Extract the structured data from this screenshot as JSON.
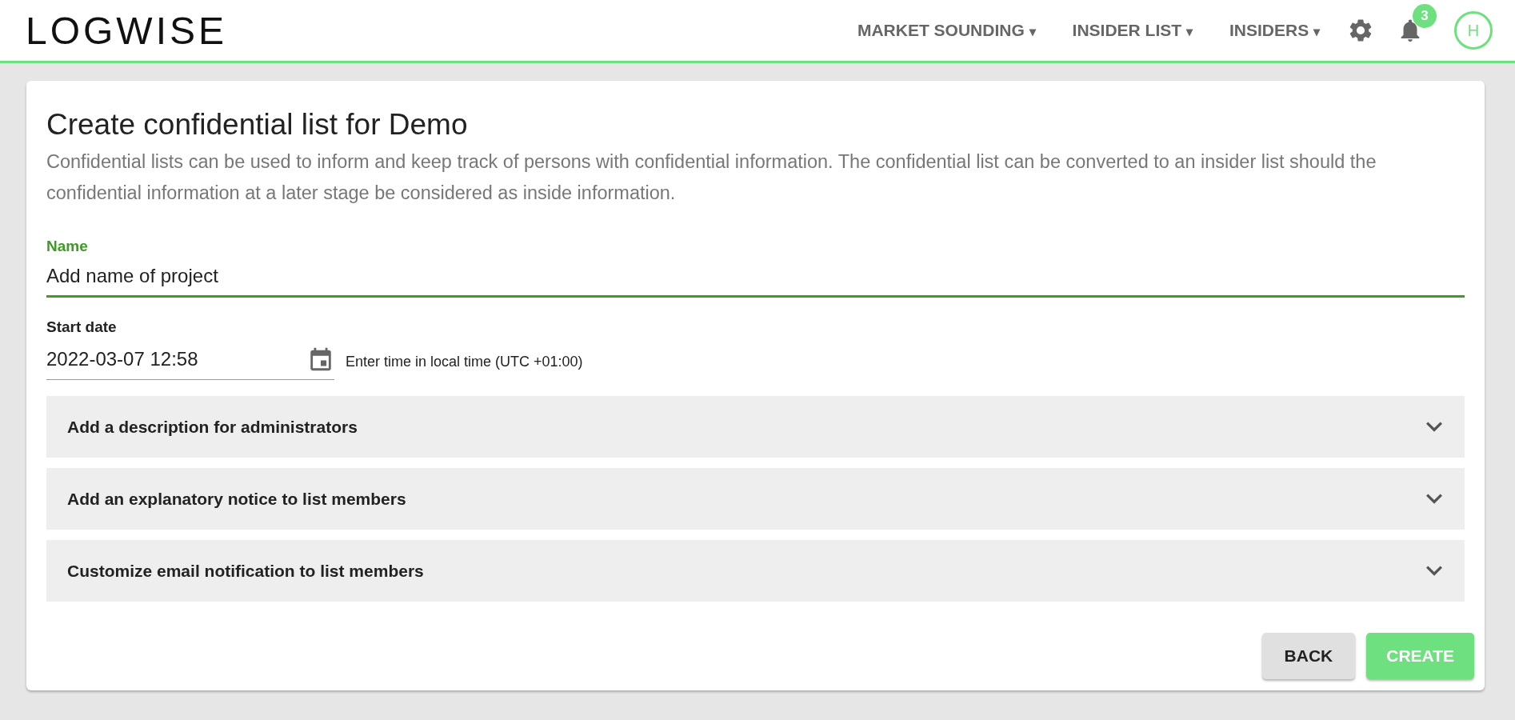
{
  "header": {
    "logo": "LOGWISE",
    "nav": [
      {
        "label": "MARKET SOUNDING",
        "caret": "▾"
      },
      {
        "label": "INSIDER LIST",
        "caret": "▾"
      },
      {
        "label": "INSIDERS",
        "caret": "▾"
      }
    ],
    "notifications": {
      "count": "3"
    },
    "avatar": {
      "initial": "H"
    }
  },
  "form": {
    "title": "Create confidential list for Demo",
    "description": "Confidential lists can be used to inform and keep track of persons with confidential information. The confidential list can be converted to an insider list should the confidential information at a later stage be considered as inside information.",
    "name_field": {
      "label": "Name",
      "placeholder": "Add name of project",
      "focused": true
    },
    "start_date": {
      "label": "Start date",
      "value": "2022-03-07 12:58",
      "hint": "Enter time in local time (UTC +01:00)"
    },
    "panels": [
      {
        "title": "Add a description for administrators",
        "expanded": false
      },
      {
        "title": "Add an explanatory notice to list members",
        "expanded": false
      },
      {
        "title": "Customize email notification to list members",
        "expanded": false
      }
    ],
    "buttons": [
      {
        "label": "BACK",
        "kind": "secondary"
      },
      {
        "label": "CREATE",
        "kind": "primary"
      }
    ]
  }
}
